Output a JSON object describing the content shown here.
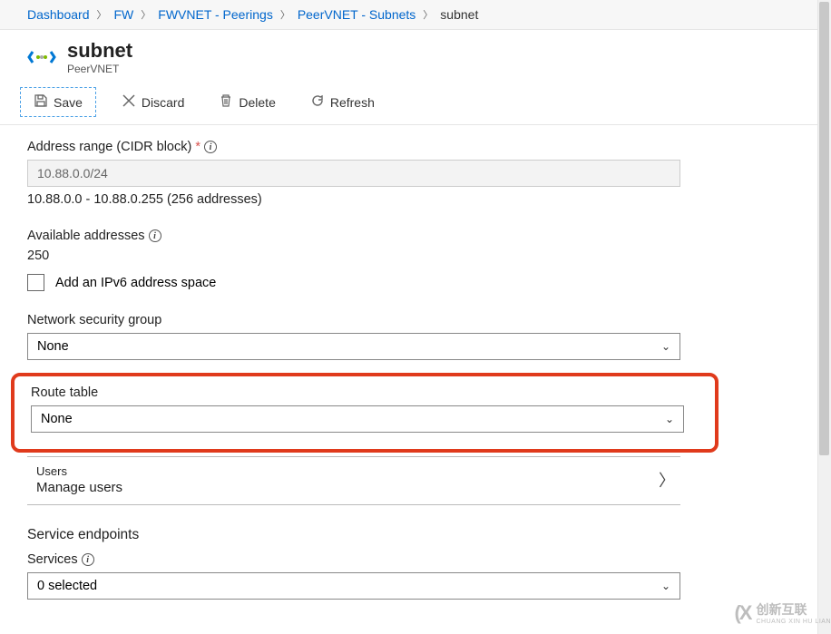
{
  "breadcrumb": {
    "items": [
      "Dashboard",
      "FW",
      "FWVNET - Peerings",
      "PeerVNET - Subnets",
      "subnet"
    ]
  },
  "header": {
    "title": "subnet",
    "subtitle": "PeerVNET"
  },
  "toolbar": {
    "save": "Save",
    "discard": "Discard",
    "delete": "Delete",
    "refresh": "Refresh"
  },
  "fields": {
    "addressRange": {
      "label": "Address range (CIDR block)",
      "value": "10.88.0.0/24",
      "hint": "10.88.0.0 - 10.88.0.255 (256 addresses)"
    },
    "available": {
      "label": "Available addresses",
      "value": "250"
    },
    "ipv6": {
      "label": "Add an IPv6 address space"
    },
    "nsg": {
      "label": "Network security group",
      "value": "None"
    },
    "routeTable": {
      "label": "Route table",
      "value": "None"
    },
    "users": {
      "title": "Users",
      "sub": "Manage users"
    },
    "serviceEndpoints": {
      "label": "Service endpoints"
    },
    "services": {
      "label": "Services",
      "value": "0 selected"
    }
  },
  "watermark": {
    "brand": "创新互联",
    "sub": "CHUANG XIN HU LIAN"
  }
}
